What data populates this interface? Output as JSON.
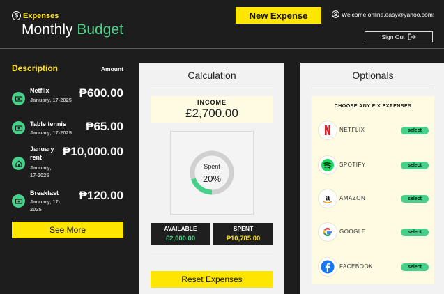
{
  "header": {
    "brand_label": "Expenses",
    "title_primary": "Monthly",
    "title_accent": "Budget",
    "new_expense_label": "New Expense",
    "welcome_text": "Welcome online.easy@yahoo.com!",
    "sign_out_label": "Sign Out"
  },
  "expenses": {
    "description_title": "Description",
    "amount_title": "Amount",
    "items": [
      {
        "name": "Netflix",
        "date": "January, 17-2025",
        "amount": "₱600.00",
        "icon": "cash-icon"
      },
      {
        "name": "Table tennis",
        "date": "January, 17-2025",
        "amount": "₱65.00",
        "icon": "cash-icon"
      },
      {
        "name": "January rent",
        "date": "January, 17-2025",
        "amount": "₱10,000.00",
        "icon": "home-icon"
      },
      {
        "name": "Breakfast",
        "date": "January, 17-2025",
        "amount": "₱120.00",
        "icon": "cash-icon"
      }
    ],
    "see_more_label": "See More"
  },
  "calculation": {
    "title": "Calculation",
    "income_label": "INCOME",
    "income_value": "£2,700.00",
    "spent_label": "Spent",
    "spent_percent": "20%",
    "spent_fraction": 0.2,
    "available_label": "AVAILABLE",
    "available_value": "£2,000.00",
    "spent_title": "SPENT",
    "spent_value": "₱10,785.00",
    "reset_label": "Reset Expenses"
  },
  "optionals": {
    "title": "Optionals",
    "heading": "CHOOSE ANY FIX EXPENSES",
    "items": [
      {
        "name": "NETFLIX",
        "select_label": "select",
        "icon": "netflix-icon"
      },
      {
        "name": "SPOTIFY",
        "select_label": "select",
        "icon": "spotify-icon"
      },
      {
        "name": "AMAZON",
        "select_label": "select",
        "icon": "amazon-icon"
      },
      {
        "name": "GOOGLE",
        "select_label": "select",
        "icon": "google-icon"
      },
      {
        "name": "FACEBOOK",
        "select_label": "select",
        "icon": "facebook-icon"
      }
    ]
  },
  "colors": {
    "background": "#1d1d1d",
    "accent_yellow": "#ffe600",
    "accent_green": "#46d08a",
    "panel": "#f2f2f2",
    "panel_inner": "#fffbe2",
    "available_value": "#4ed28a",
    "spent_value": "#ffe11b"
  }
}
